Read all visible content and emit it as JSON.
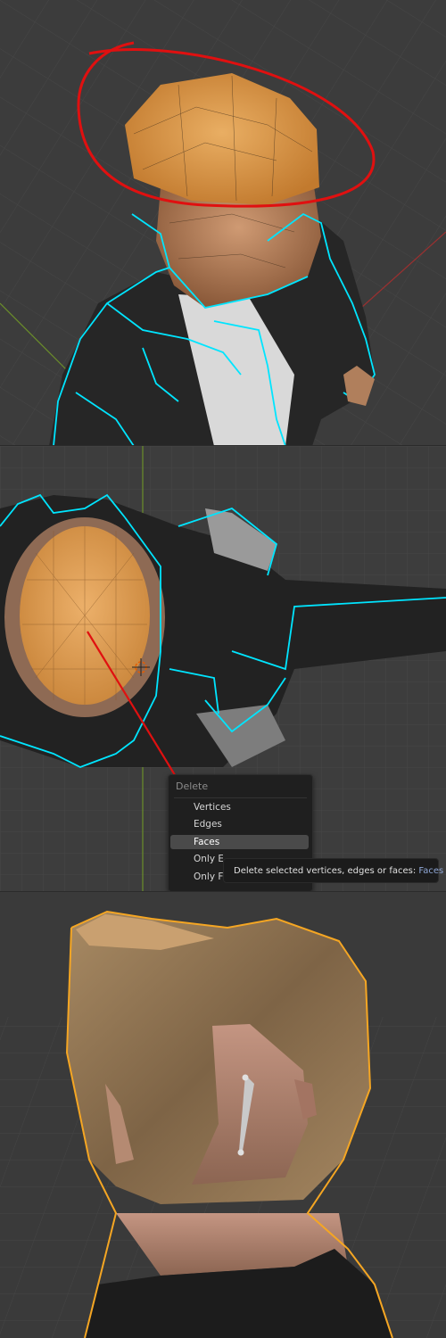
{
  "viewport_1": {
    "annotation": "red-freehand-ellipse"
  },
  "viewport_2": {
    "context_menu": {
      "title": "Delete",
      "items": [
        {
          "label": "Vertices",
          "active": false
        },
        {
          "label": "Edges",
          "active": false
        },
        {
          "label": "Faces",
          "active": true
        },
        {
          "label": "Only Edges & Faces",
          "active": false
        },
        {
          "label": "Only Faces",
          "active": false
        }
      ]
    },
    "tooltip": {
      "text": "Delete selected vertices, edges or faces:",
      "value": "Faces"
    },
    "annotation": "red-arrow"
  },
  "viewport_3": {},
  "colors": {
    "selection_outline": "#00e5ff",
    "selected_face": "#e8a54a",
    "annotation": "#e01010",
    "active_object_outline": "#f5a623"
  }
}
